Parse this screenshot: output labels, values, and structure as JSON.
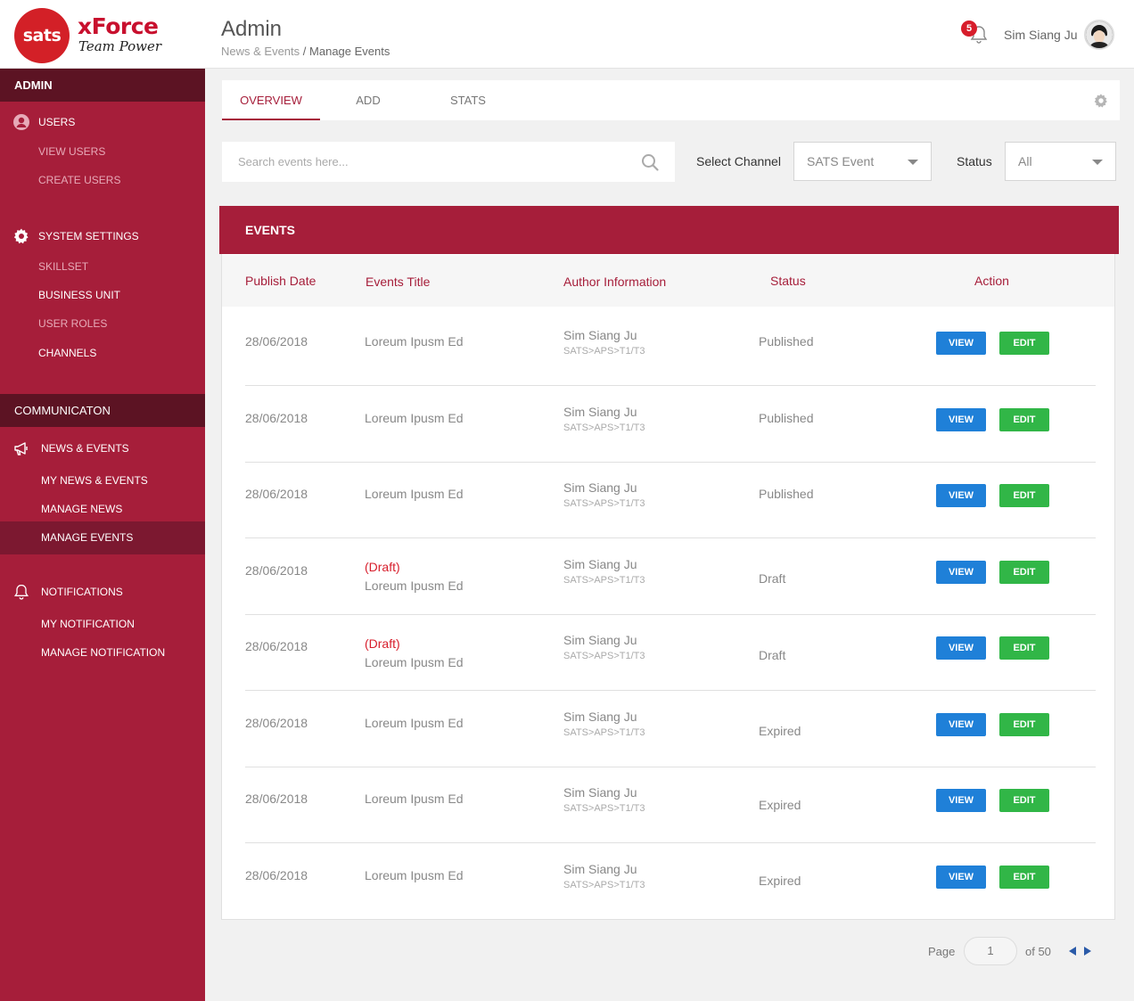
{
  "app": {
    "logo_text": "sats",
    "brand": "xForce",
    "tagline": "Team Power",
    "page_title": "Admin",
    "breadcrumb": {
      "parent": "News & Events",
      "separator": "/",
      "current": "Manage Events"
    },
    "notifications_count": "5",
    "user_name": "Sim Siang Ju"
  },
  "sidebar": {
    "admin_section": "ADMIN",
    "users_label": "USERS",
    "view_users": "VIEW USERS",
    "create_users": "CREATE USERS",
    "system_settings_label": "SYSTEM SETTINGS",
    "skillset": "SKILLSET",
    "business_unit": "BUSINESS UNIT",
    "user_roles": "USER ROLES",
    "channels": "CHANNELS",
    "communication_section": "COMMUNICATON",
    "news_events_label": "NEWS & EVENTS",
    "my_news_events": "MY NEWS & EVENTS",
    "manage_news": "MANAGE NEWS",
    "manage_events": "MANAGE EVENTS",
    "notifications_label": "NOTIFICATIONS",
    "my_notification": "MY NOTIFICATION",
    "manage_notification": "MANAGE NOTIFICATION"
  },
  "tabs": {
    "overview": "OVERVIEW",
    "add": "ADD",
    "stats": "STATS"
  },
  "filters": {
    "search_placeholder": "Search events here...",
    "channel_label": "Select Channel",
    "channel_value": "SATS Event",
    "status_label": "Status",
    "status_value": "All"
  },
  "events": {
    "title": "EVENTS",
    "columns": {
      "publish_date": "Publish Date",
      "title": "Events Title",
      "author": "Author Information",
      "status": "Status",
      "action": "Action"
    },
    "view_label": "VIEW",
    "edit_label": "EDIT",
    "draft_tag": "(Draft)",
    "rows": [
      {
        "date": "28/06/2018",
        "title": "Loreum Ipusm Ed",
        "author": "Sim Siang Ju",
        "author_path": "SATS>APS>T1/T3",
        "status": "Published"
      },
      {
        "date": "28/06/2018",
        "title": "Loreum Ipusm Ed",
        "author": "Sim Siang Ju",
        "author_path": "SATS>APS>T1/T3",
        "status": "Published"
      },
      {
        "date": "28/06/2018",
        "title": "Loreum Ipusm Ed",
        "author": "Sim Siang Ju",
        "author_path": "SATS>APS>T1/T3",
        "status": "Published"
      },
      {
        "date": "28/06/2018",
        "title": "Loreum Ipusm Ed",
        "author": "Sim Siang Ju",
        "author_path": "SATS>APS>T1/T3",
        "status": "Draft"
      },
      {
        "date": "28/06/2018",
        "title": "Loreum Ipusm Ed",
        "author": "Sim Siang Ju",
        "author_path": "SATS>APS>T1/T3",
        "status": "Draft"
      },
      {
        "date": "28/06/2018",
        "title": "Loreum Ipusm Ed",
        "author": "Sim Siang Ju",
        "author_path": "SATS>APS>T1/T3",
        "status": "Expired"
      },
      {
        "date": "28/06/2018",
        "title": "Loreum Ipusm Ed",
        "author": "Sim Siang Ju",
        "author_path": "SATS>APS>T1/T3",
        "status": "Expired"
      },
      {
        "date": "28/06/2018",
        "title": "Loreum Ipusm Ed",
        "author": "Sim Siang Ju",
        "author_path": "SATS>APS>T1/T3",
        "status": "Expired"
      }
    ]
  },
  "pagination": {
    "page_label": "Page",
    "current": "1",
    "of_label": "of 50"
  },
  "colors": {
    "brand_red": "#a61e3a",
    "section_dark": "#5c1323",
    "view_blue": "#1f80d8",
    "edit_green": "#31b647",
    "draft_red": "#d71d2b"
  }
}
